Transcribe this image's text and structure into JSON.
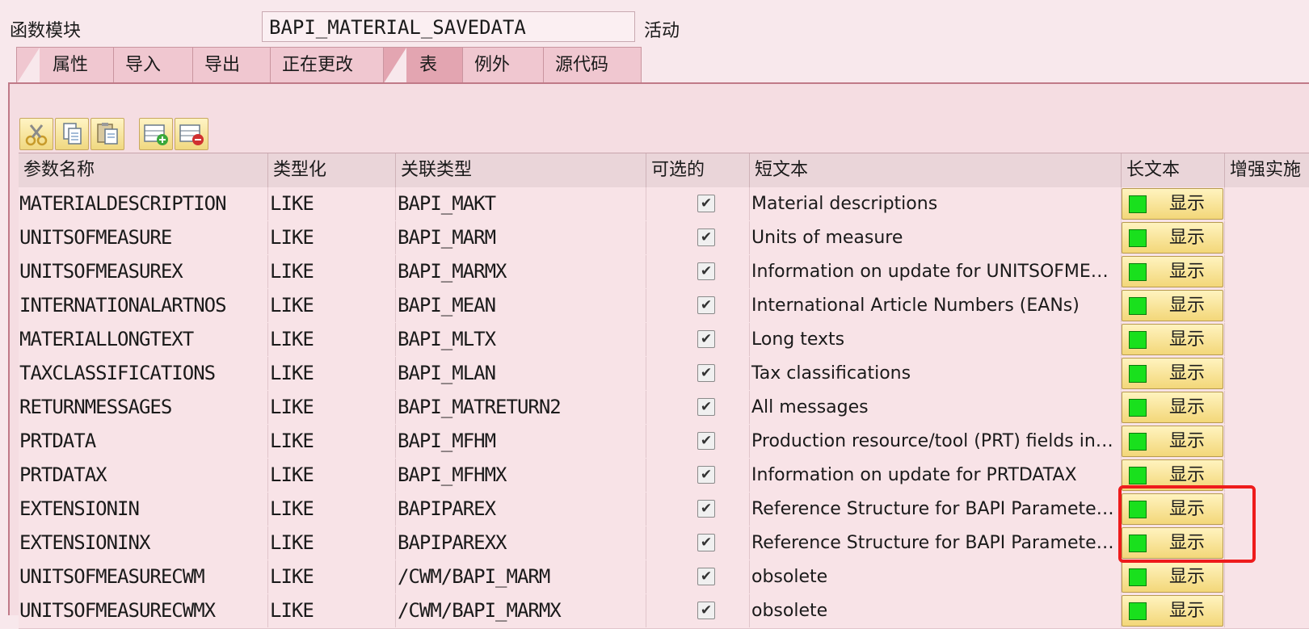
{
  "header": {
    "label": "函数模块",
    "function_name": "BAPI_MATERIAL_SAVEDATA",
    "status": "活动"
  },
  "tabs": [
    {
      "label": "属性",
      "active": false
    },
    {
      "label": "导入",
      "active": false
    },
    {
      "label": "导出",
      "active": false
    },
    {
      "label": "正在更改",
      "active": false
    },
    {
      "label": "表",
      "active": true
    },
    {
      "label": "例外",
      "active": false
    },
    {
      "label": "源代码",
      "active": false
    }
  ],
  "toolbar": [
    {
      "icon": "cut-icon"
    },
    {
      "icon": "copy-icon"
    },
    {
      "icon": "paste-icon"
    },
    {
      "icon": "insert-row-icon"
    },
    {
      "icon": "delete-row-icon"
    }
  ],
  "columns": {
    "param": "参数名称",
    "typing": "类型化",
    "ref_type": "关联类型",
    "optional": "可选的",
    "short_text": "短文本",
    "long_text": "长文本",
    "enhancement": "增强实施"
  },
  "rows": [
    {
      "param": "MATERIALDESCRIPTION",
      "typing": "LIKE",
      "ref_type": "BAPI_MAKT",
      "optional": true,
      "short_text": "Material descriptions",
      "long_text": "显示"
    },
    {
      "param": "UNITSOFMEASURE",
      "typing": "LIKE",
      "ref_type": "BAPI_MARM",
      "optional": true,
      "short_text": "Units of measure",
      "long_text": "显示"
    },
    {
      "param": "UNITSOFMEASUREX",
      "typing": "LIKE",
      "ref_type": "BAPI_MARMX",
      "optional": true,
      "short_text": "Information on update for UNITSOFMEAS…",
      "long_text": "显示"
    },
    {
      "param": "INTERNATIONALARTNOS",
      "typing": "LIKE",
      "ref_type": "BAPI_MEAN",
      "optional": true,
      "short_text": "International Article Numbers (EANs)",
      "long_text": "显示"
    },
    {
      "param": "MATERIALLONGTEXT",
      "typing": "LIKE",
      "ref_type": "BAPI_MLTX",
      "optional": true,
      "short_text": "Long texts",
      "long_text": "显示"
    },
    {
      "param": "TAXCLASSIFICATIONS",
      "typing": "LIKE",
      "ref_type": "BAPI_MLAN",
      "optional": true,
      "short_text": "Tax classifications",
      "long_text": "显示"
    },
    {
      "param": "RETURNMESSAGES",
      "typing": "LIKE",
      "ref_type": "BAPI_MATRETURN2",
      "optional": true,
      "short_text": "All messages",
      "long_text": "显示"
    },
    {
      "param": "PRTDATA",
      "typing": "LIKE",
      "ref_type": "BAPI_MFHM",
      "optional": true,
      "short_text": "Production resource/tool (PRT) fields in th…",
      "long_text": "显示"
    },
    {
      "param": "PRTDATAX",
      "typing": "LIKE",
      "ref_type": "BAPI_MFHMX",
      "optional": true,
      "short_text": "Information on update for PRTDATAX",
      "long_text": "显示"
    },
    {
      "param": "EXTENSIONIN",
      "typing": "LIKE",
      "ref_type": "BAPIPAREX",
      "optional": true,
      "short_text": "Reference Structure for BAPI Parameters …",
      "long_text": "显示"
    },
    {
      "param": "EXTENSIONINX",
      "typing": "LIKE",
      "ref_type": "BAPIPAREXX",
      "optional": true,
      "short_text": "Reference Structure for BAPI Parameters …",
      "long_text": "显示"
    },
    {
      "param": "UNITSOFMEASURECWM",
      "typing": "LIKE",
      "ref_type": "/CWM/BAPI_MARM",
      "optional": true,
      "short_text": "obsolete",
      "long_text": "显示"
    },
    {
      "param": "UNITSOFMEASURECWMX",
      "typing": "LIKE",
      "ref_type": "/CWM/BAPI_MARMX",
      "optional": true,
      "short_text": "obsolete",
      "long_text": "显示"
    }
  ],
  "colors": {
    "background": "#f8e8ec",
    "status_led": "#19e01d",
    "highlight_border": "#ee1c1c"
  }
}
